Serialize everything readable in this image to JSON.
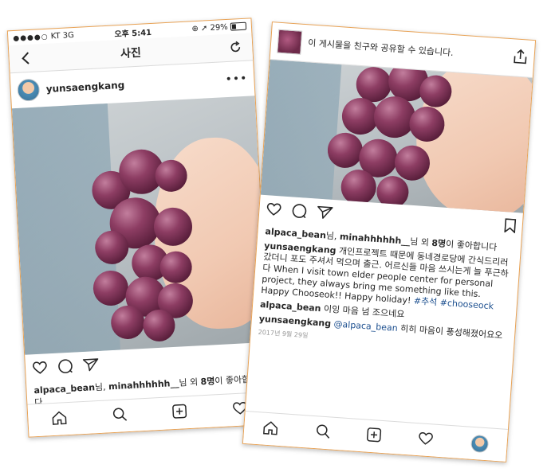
{
  "left": {
    "status": {
      "carrier": "KT",
      "network": "3G",
      "time": "오후 5:41",
      "battery": "29%"
    },
    "nav_title": "사진",
    "username": "yunsaengkang",
    "likes": {
      "users": "alpaca_bean",
      "mid": "님, ",
      "user2": "minahhhhhh__",
      "suffix": "님 외 ",
      "count": "8명",
      "tail": "이 좋아합니다"
    }
  },
  "right": {
    "share_text": "이 게시물을 친구와 공유할 수 있습니다.",
    "likes": {
      "users": "alpaca_bean",
      "mid": "님, ",
      "user2": "minahhhhhh__",
      "suffix": "님 외 ",
      "count": "8명",
      "tail": "이 좋아합니다"
    },
    "caption": {
      "user": "yunsaengkang",
      "korean": "개인프로젝트 때문에 동네경로당에 간식드리러 갔더니 포도 주셔서 먹으며 출근. 어르신들 마음 쓰시는게 늘 푸근하다",
      "english": "When I visit town elder people center for personal project, they always bring me something like this. Happy Chooseok!! Happy holiday!",
      "tag1": "#추석",
      "tag2": "#chooseock"
    },
    "comments": [
      {
        "user": "alpaca_bean",
        "text": "이잉 마음 넘 조으네요",
        "mention": ""
      },
      {
        "user": "yunsaengkang",
        "mention": "@alpaca_bean",
        "text": "히히 마음이 풍성해졌어요오"
      }
    ],
    "date": "2017년 9월 29일"
  },
  "icons": [
    "back-arrow-icon",
    "refresh-icon",
    "more-icon",
    "heart-icon",
    "comment-icon",
    "send-icon",
    "bookmark-icon",
    "home-icon",
    "search-icon",
    "add-icon",
    "activity-icon",
    "profile-icon",
    "share-icon"
  ]
}
